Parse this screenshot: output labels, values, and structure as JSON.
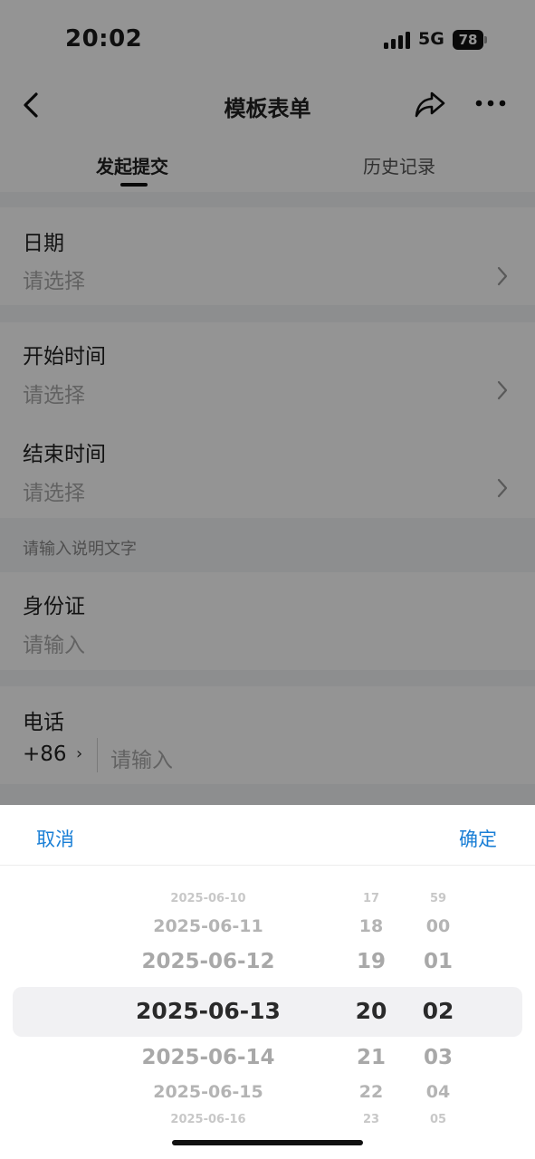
{
  "status_bar": {
    "time": "20:02",
    "network": "5G",
    "battery": "78"
  },
  "nav": {
    "title": "模板表单"
  },
  "tabs": [
    {
      "label": "发起提交",
      "active": true
    },
    {
      "label": "历史记录",
      "active": false
    }
  ],
  "form": {
    "date": {
      "label": "日期",
      "placeholder": "请选择"
    },
    "start_time": {
      "label": "开始时间",
      "placeholder": "请选择"
    },
    "end_time": {
      "label": "结束时间",
      "placeholder": "请选择"
    },
    "note": "请输入说明文字",
    "id_card": {
      "label": "身份证",
      "placeholder": "请输入"
    },
    "phone": {
      "label": "电话",
      "country_code": "+86",
      "caret": "›",
      "placeholder": "请输入"
    }
  },
  "picker": {
    "cancel": "取消",
    "confirm": "确定",
    "dates": [
      "2025-06-10",
      "2025-06-11",
      "2025-06-12",
      "2025-06-13",
      "2025-06-14",
      "2025-06-15",
      "2025-06-16"
    ],
    "hours": [
      "17",
      "18",
      "19",
      "20",
      "21",
      "22",
      "23"
    ],
    "minutes": [
      "59",
      "00",
      "01",
      "02",
      "03",
      "04",
      "05"
    ],
    "selected": {
      "date": "2025-06-13",
      "hour": "20",
      "minute": "02"
    }
  },
  "colors": {
    "accent": "#1a7fd6",
    "mask": "rgba(0,0,0,0.42)"
  }
}
